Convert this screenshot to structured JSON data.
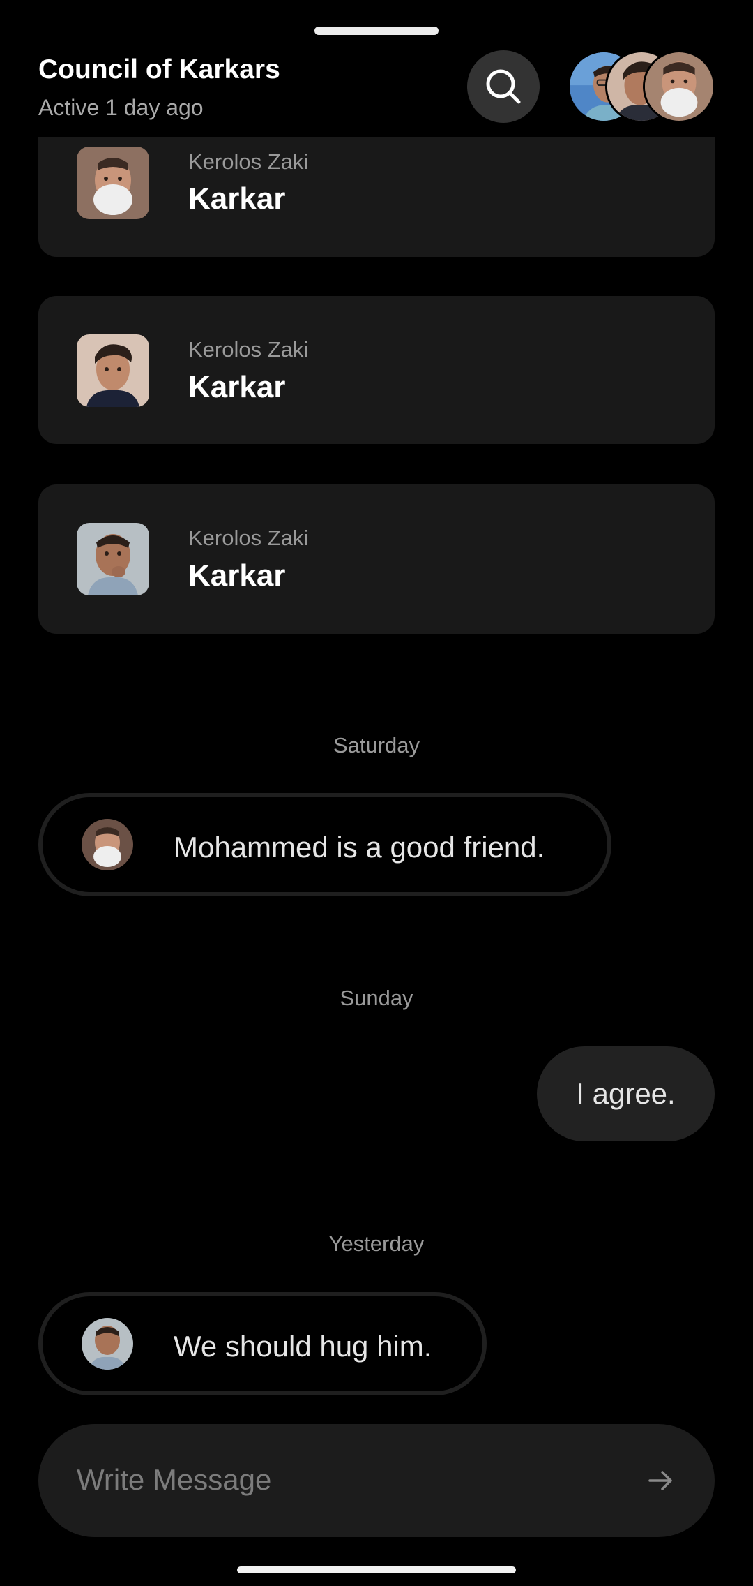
{
  "header": {
    "title": "Council of Karkars",
    "subtitle": "Active 1 day ago",
    "search_icon": "search-icon",
    "avatar_count": 3
  },
  "cards": [
    {
      "sender": "Kerolos Zaki",
      "name": "Karkar"
    },
    {
      "sender": "Kerolos Zaki",
      "name": "Karkar"
    },
    {
      "sender": "Kerolos Zaki",
      "name": "Karkar"
    }
  ],
  "messages": [
    {
      "day": "Saturday",
      "direction": "incoming",
      "text": "Mohammed is a good friend."
    },
    {
      "day": "Sunday",
      "direction": "outgoing",
      "text": "I agree."
    },
    {
      "day": "Yesterday",
      "direction": "incoming",
      "text": "We should hug him."
    }
  ],
  "composer": {
    "placeholder": "Write Message",
    "send_icon": "arrow-right-icon"
  },
  "colors": {
    "background": "#000000",
    "card": "#191919",
    "outgoing_bubble": "#222222",
    "muted_text": "#9a9a9a"
  }
}
